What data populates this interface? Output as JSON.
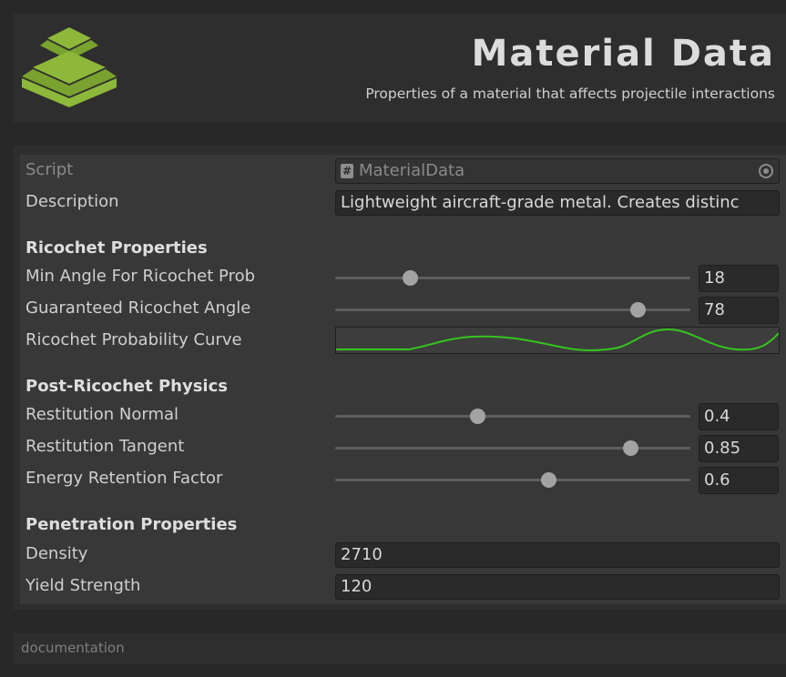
{
  "header": {
    "title": "Material Data",
    "subtitle": "Properties of a material that affects projectile interactions",
    "logo_icon": "stacked-layers-icon",
    "logo_color": "#8db83a"
  },
  "fields": {
    "script": {
      "label": "Script",
      "value": "MaterialData",
      "icon": "script-file-icon"
    },
    "description": {
      "label": "Description",
      "value": "Lightweight aircraft-grade metal. Creates distinc"
    }
  },
  "ricochet": {
    "heading": "Ricochet Properties",
    "min_angle": {
      "label": "Min Angle For Ricochet Prob",
      "value": "18",
      "fraction": 0.21
    },
    "guaranteed_angle": {
      "label": "Guaranteed Ricochet Angle",
      "value": "78",
      "fraction": 0.85
    },
    "curve": {
      "label": "Ricochet Probability Curve",
      "color": "#35c41e"
    }
  },
  "post_ricochet": {
    "heading": "Post-Ricochet Physics",
    "restitution_normal": {
      "label": "Restitution Normal",
      "value": "0.4",
      "fraction": 0.4
    },
    "restitution_tangent": {
      "label": "Restitution Tangent",
      "value": "0.85",
      "fraction": 0.83
    },
    "energy_retention": {
      "label": "Energy Retention Factor",
      "value": "0.6",
      "fraction": 0.6
    }
  },
  "penetration": {
    "heading": "Penetration Properties",
    "density": {
      "label": "Density",
      "value": "2710"
    },
    "yield_strength": {
      "label": "Yield Strength",
      "value": "120"
    }
  },
  "footer": {
    "label": "documentation"
  }
}
